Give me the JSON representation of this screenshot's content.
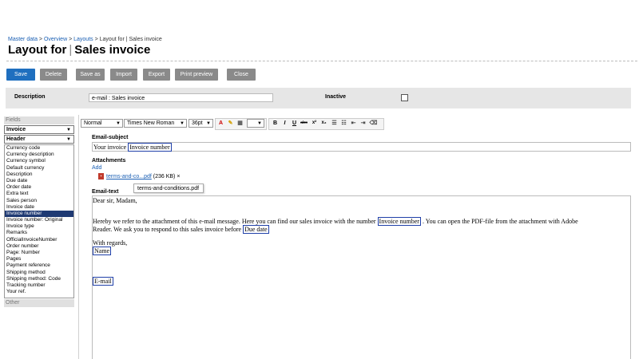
{
  "breadcrumb": [
    "Master data",
    "Overview",
    "Layouts",
    "Layout for | Sales invoice"
  ],
  "title": {
    "prefix": "Layout for",
    "suffix": "Sales invoice"
  },
  "buttons": {
    "save": "Save",
    "delete": "Delete",
    "save_as": "Save as",
    "import": "Import",
    "export": "Export",
    "print_preview": "Print preview",
    "close": "Close"
  },
  "description": {
    "label": "Description",
    "value": "e-mail : Sales invoice",
    "inactive_label": "Inactive"
  },
  "fields_panel": {
    "header": "Fields",
    "type_select": "Invoice",
    "section_select": "Header",
    "items": [
      "Currency code",
      "Currency description",
      "Currency symbol",
      "Default currency",
      "Description",
      "Due date",
      "Order date",
      "Extra text",
      "Sales person",
      "Invoice date",
      "Invoice number",
      "Invoice number: Original",
      "Invoice type",
      "Remarks",
      "OfficialInvoiceNumber",
      "Order number",
      "Page: Number",
      "Pages",
      "Payment reference",
      "Shipping method",
      "Shipping method: Code",
      "Tracking number",
      "Your ref."
    ],
    "selected_item": "Invoice number",
    "other": "Other"
  },
  "toolbar": {
    "style": "Normal",
    "font": "Times New Roman",
    "size": "36pt",
    "buttons": [
      "B",
      "I",
      "U",
      "abc",
      "x²",
      "x₂"
    ]
  },
  "email_subject": {
    "label": "Email-subject",
    "text": "Your invoice",
    "token": "Invoice number"
  },
  "attachments": {
    "label": "Attachments",
    "add": "Add",
    "file": "terms-and-co...pdf",
    "size": "(236 KB)",
    "remove": "×",
    "tooltip": "terms-and-conditions.pdf"
  },
  "email_text": {
    "label": "Email-text",
    "greeting": "Dear sir, Madam,",
    "para_part1": "Hereby we refer to the attachment of this e-mail message. Here you can find our sales invoice with the number",
    "para_token": "Invoice number",
    "para_part2": ". You can open the PDF-file from the attachment with Adobe",
    "para_line2": "Reader. We ask you to respond to this sales invoice before",
    "para_token2": "Due date",
    "regards": "With regards,",
    "name_token": "Name",
    "email_token": "E-mail"
  }
}
